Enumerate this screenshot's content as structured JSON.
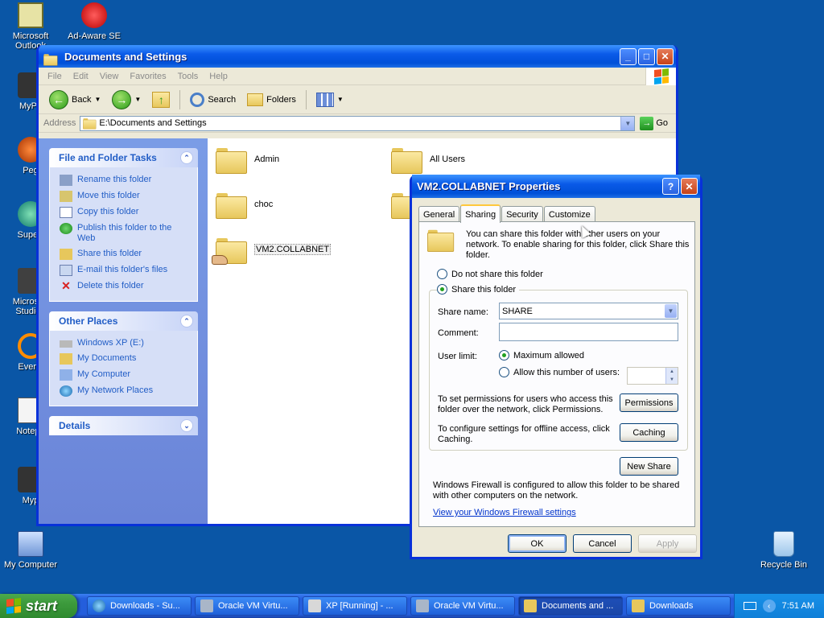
{
  "desktop": {
    "icons": [
      {
        "label": "Microsoft Outlook"
      },
      {
        "label": "Ad-Aware SE"
      },
      {
        "label": "MyPa"
      },
      {
        "label": "Peg"
      },
      {
        "label": "Superr"
      },
      {
        "label": "Microsoft Studio :"
      },
      {
        "label": "Everyt"
      },
      {
        "label": "Notepa"
      },
      {
        "label": "Myp"
      },
      {
        "label": "My Computer"
      },
      {
        "label": "Recycle Bin"
      }
    ]
  },
  "explorer": {
    "title": "Documents and Settings",
    "menu": [
      "File",
      "Edit",
      "View",
      "Favorites",
      "Tools",
      "Help"
    ],
    "toolbar": {
      "back": "Back",
      "search": "Search",
      "folders": "Folders"
    },
    "address_label": "Address",
    "address_value": "E:\\Documents and Settings",
    "go_label": "Go",
    "file_tasks": {
      "title": "File and Folder Tasks",
      "items": [
        "Rename this folder",
        "Move this folder",
        "Copy this folder",
        "Publish this folder to the Web",
        "Share this folder",
        "E-mail this folder's files",
        "Delete this folder"
      ]
    },
    "other_places": {
      "title": "Other Places",
      "items": [
        "Windows XP (E:)",
        "My Documents",
        "My Computer",
        "My Network Places"
      ]
    },
    "details_title": "Details",
    "files": [
      "Admin",
      "All Users",
      "choc",
      "VM2.COLLABNET"
    ]
  },
  "dialog": {
    "title": "VM2.COLLABNET Properties",
    "tabs": [
      "General",
      "Sharing",
      "Security",
      "Customize"
    ],
    "intro": "You can share this folder with other users on your network.  To enable sharing for this folder, click Share this folder.",
    "do_not_share": "Do not share this folder",
    "share_this": "Share this folder",
    "share_name_label": "Share name:",
    "share_name_value": "SHARE",
    "comment_label": "Comment:",
    "comment_value": "",
    "user_limit_label": "User limit:",
    "max_allowed": "Maximum allowed",
    "allow_number": "Allow this number of users:",
    "perm_text": "To set permissions for users who access this folder over the network, click Permissions.",
    "perm_button": "Permissions",
    "cache_text": "To configure settings for offline access, click Caching.",
    "cache_button": "Caching",
    "new_share": "New Share",
    "firewall_text": "Windows Firewall is configured to allow this folder to be shared with other computers on the network.",
    "firewall_link": "View your Windows Firewall settings",
    "ok": "OK",
    "cancel": "Cancel",
    "apply": "Apply"
  },
  "taskbar": {
    "start": "start",
    "tasks": [
      "Downloads - Su...",
      "Oracle VM Virtu...",
      "XP [Running] - ...",
      "Oracle VM Virtu...",
      "Documents and ...",
      "Downloads"
    ],
    "time": "7:51 AM"
  }
}
